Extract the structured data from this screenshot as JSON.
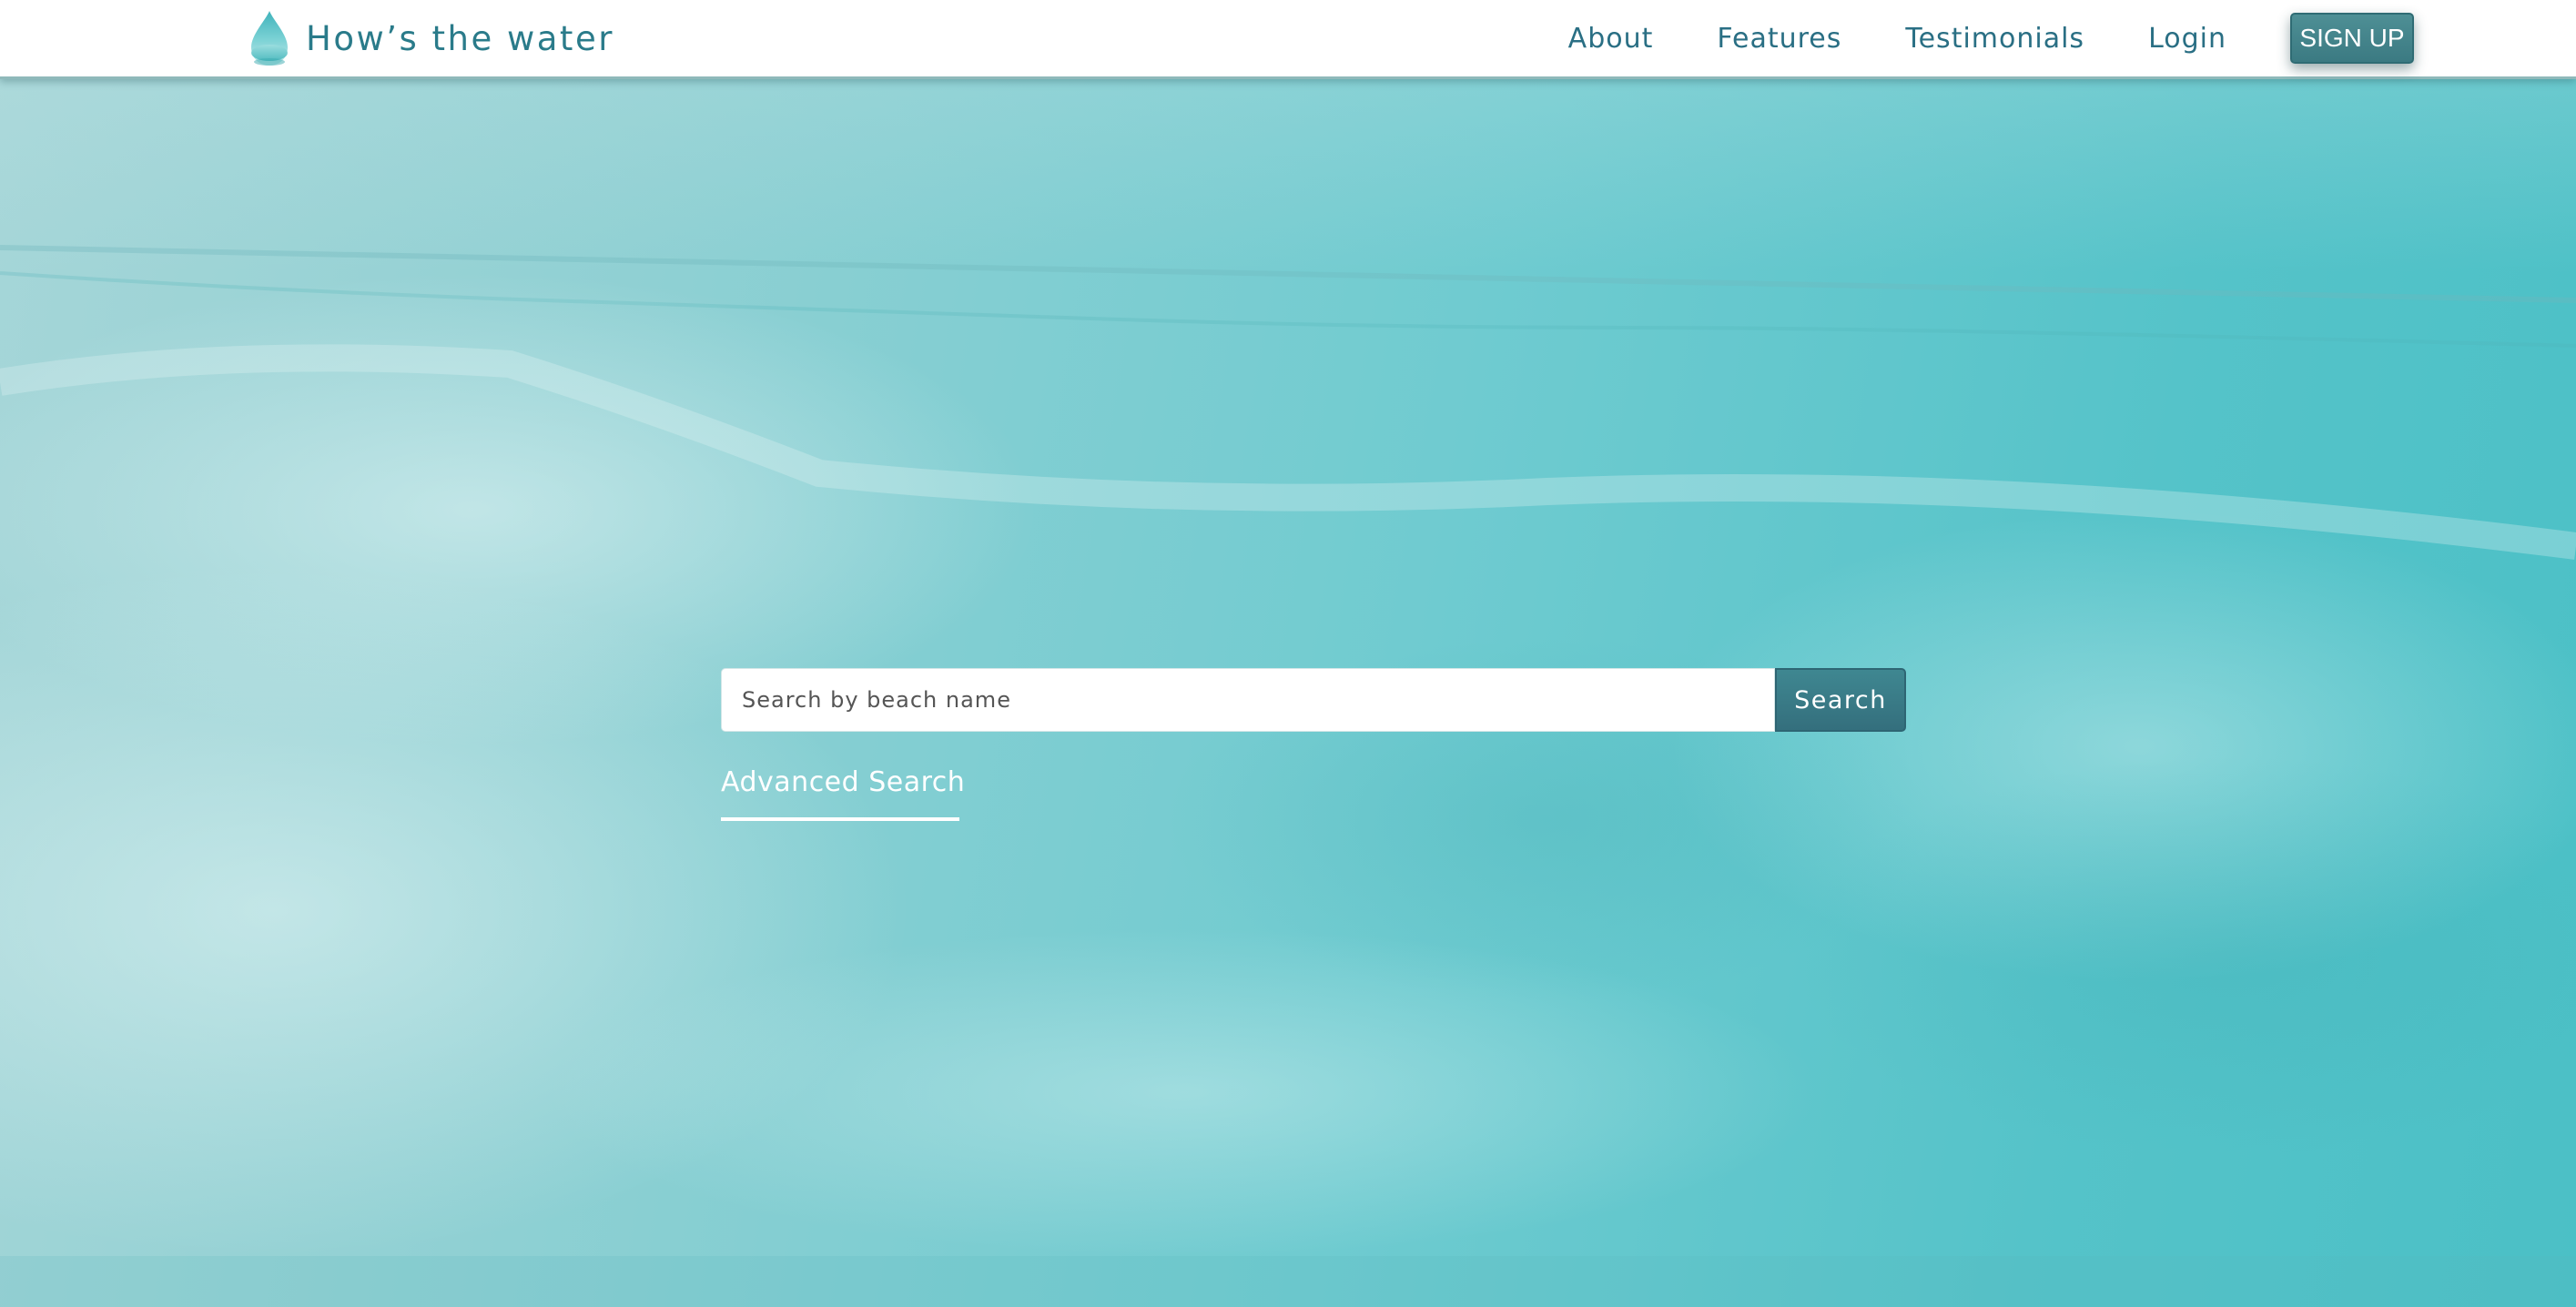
{
  "brand": {
    "name": "How’s the water",
    "icon": "water-drop-icon"
  },
  "nav": {
    "items": [
      {
        "label": "About"
      },
      {
        "label": "Features"
      },
      {
        "label": "Testimonials"
      },
      {
        "label": "Login"
      }
    ],
    "signup_label": "SIGN UP"
  },
  "search": {
    "placeholder": "Search by beach name",
    "value": "",
    "button_label": "Search",
    "advanced_label": "Advanced Search"
  },
  "colors": {
    "brand_text": "#2a7b8a",
    "nav_text": "#2a6f84",
    "button": "#3b7a82",
    "sea": "#55c3c9"
  }
}
